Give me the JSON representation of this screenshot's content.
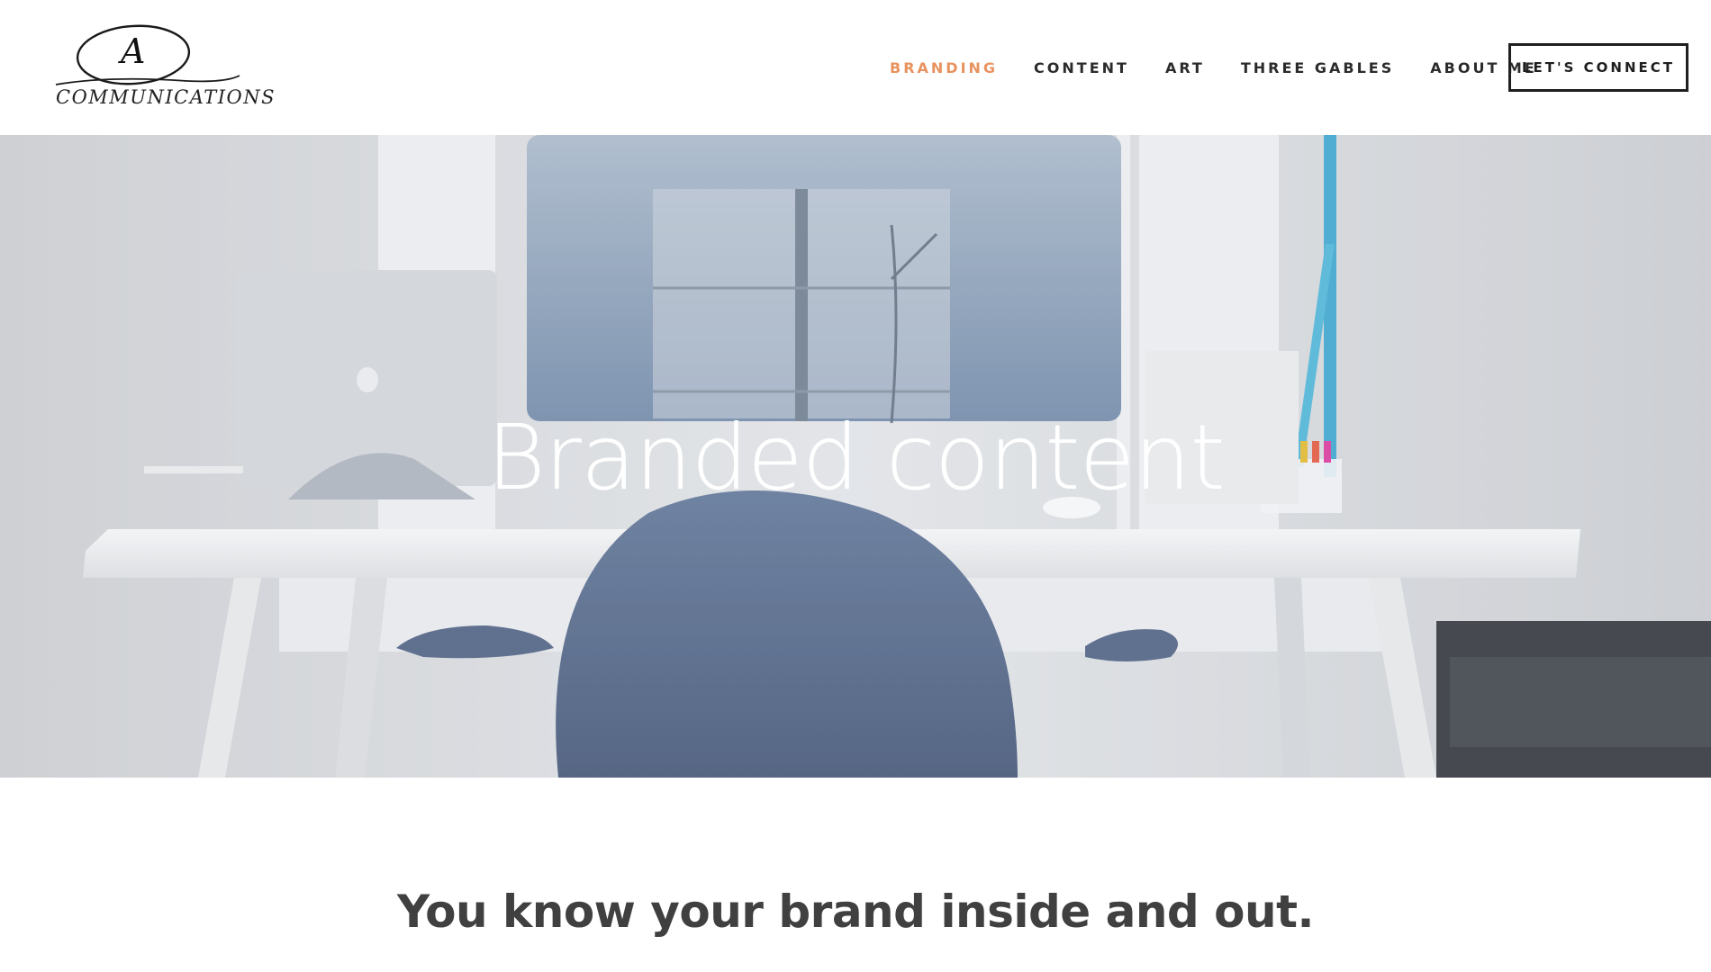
{
  "logo": {
    "initial": "A",
    "wordmark": "COMMUNICATIONS"
  },
  "nav": {
    "items": [
      {
        "label": "BRANDING",
        "active": true
      },
      {
        "label": "CONTENT",
        "active": false
      },
      {
        "label": "ART",
        "active": false
      },
      {
        "label": "THREE GABLES",
        "active": false
      },
      {
        "label": "ABOUT ME",
        "active": false
      }
    ],
    "cta_label": "LET'S CONNECT"
  },
  "hero": {
    "title": "Branded content"
  },
  "main": {
    "headline": "You know your brand inside and out."
  },
  "colors": {
    "accent": "#e8935f",
    "text": "#2b2b2b",
    "headline": "#404040"
  }
}
